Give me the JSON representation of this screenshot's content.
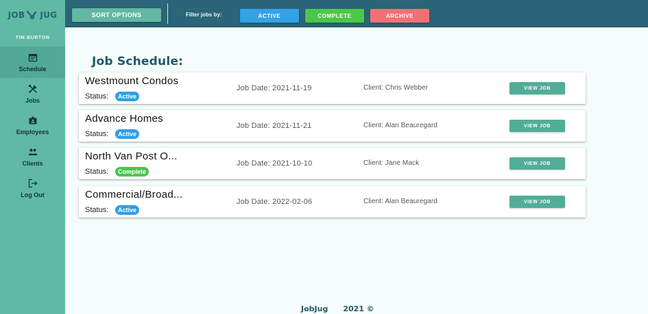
{
  "brand": {
    "left": "JOB",
    "right": "JUG",
    "logo_icon": "wrench-hook-icon"
  },
  "user": {
    "name": "TIM BURTON"
  },
  "sidebar": {
    "items": [
      {
        "label": "Schedule",
        "icon": "calendar-icon",
        "active": true
      },
      {
        "label": "Jobs",
        "icon": "tools-icon",
        "active": false
      },
      {
        "label": "Employees",
        "icon": "badge-icon",
        "active": false
      },
      {
        "label": "Clients",
        "icon": "people-icon",
        "active": false
      },
      {
        "label": "Log Out",
        "icon": "logout-icon",
        "active": false
      }
    ]
  },
  "toolbar": {
    "sort_label": "SORT OPTIONS",
    "filter_label": "Filter jobs by:",
    "filters": [
      {
        "label": "ACTIVE",
        "color": "#32a2e9"
      },
      {
        "label": "COMPLETE",
        "color": "#4cc848"
      },
      {
        "label": "ARCHIVE",
        "color": "#f07275"
      }
    ]
  },
  "main": {
    "title": "Job Schedule:",
    "status_label": "Status:",
    "view_label": "VIEW JOB",
    "jobs": [
      {
        "name": "Westmount Condos",
        "status": "Active",
        "date": "Job Date: 2021-11-19",
        "client": "Client: Chris Webber"
      },
      {
        "name": "Advance Homes",
        "status": "Active",
        "date": "Job Date: 2021-11-21",
        "client": "Client: Alan Beauregard"
      },
      {
        "name": "North Van Post O...",
        "status": "Complete",
        "date": "Job Date: 2021-10-10",
        "client": "Client: Jane Mack"
      },
      {
        "name": "Commercial/Broad...",
        "status": "Active",
        "date": "Job Date: 2022-02-06",
        "client": "Client: Alan Beauregard"
      }
    ]
  },
  "footer": {
    "brand": "JobJug",
    "year": "2021 ©"
  },
  "colors": {
    "sidebar": "#5fb9a3",
    "topbar": "#2b6577",
    "accent": "#52ad98",
    "active": "#2f9ee5",
    "complete": "#4bc54c",
    "archive": "#f07275"
  }
}
